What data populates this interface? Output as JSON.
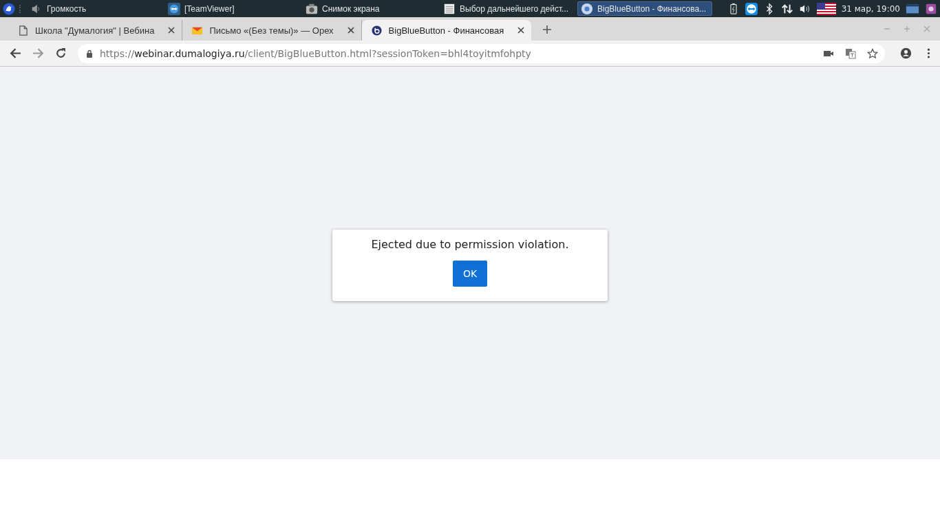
{
  "taskbar": {
    "windows": [
      {
        "label": "Громкость",
        "selected": false
      },
      {
        "label": "[TeamViewer]",
        "selected": false
      },
      {
        "label": "Снимок экрана",
        "selected": false
      },
      {
        "label": "Выбор дальнейшего дейст...",
        "selected": false
      },
      {
        "label": "BigBlueButton - Финансова...",
        "selected": true
      }
    ],
    "clock": "31 мар, 19:00"
  },
  "browser": {
    "tabs": [
      {
        "title": "Школа \"Думалогия\" | Вебина",
        "selected": false
      },
      {
        "title": "Письмо «(Без темы)» — Орех",
        "selected": false
      },
      {
        "title": "BigBlueButton - Финансовая",
        "selected": true
      }
    ],
    "url": {
      "scheme": "https://",
      "host": "webinar.dumalogiya.ru",
      "path": "/client/BigBlueButton.html?sessionToken=bhl4toyitmfohpty"
    }
  },
  "dialog": {
    "message": "Ejected due to permission violation.",
    "button": "OK"
  }
}
